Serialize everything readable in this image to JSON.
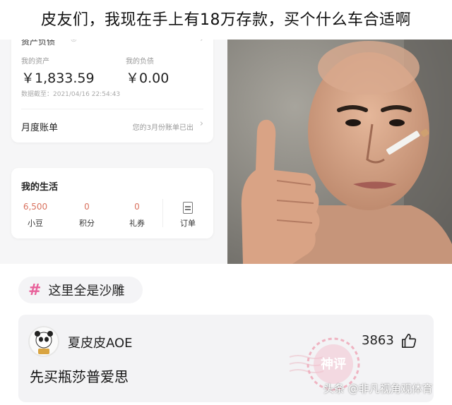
{
  "headline": "皮友们，我现在手上有18万存款，买个什么车合适啊",
  "screenshot": {
    "assets_title": "资产负债",
    "my_assets_label": "我的资产",
    "my_assets_value": "￥1,833.59",
    "my_debt_label": "我的负债",
    "my_debt_value": "￥0.00",
    "data_as_of": "数据截至：2021/04/16 22:54:43",
    "monthly_bill_title": "月度账单",
    "monthly_bill_note": "您的3月份账单已出",
    "life_title": "我的生活",
    "life_items": [
      {
        "num": "6,500",
        "label": "小豆"
      },
      {
        "num": "0",
        "label": "积分"
      },
      {
        "num": "0",
        "label": "礼券"
      }
    ],
    "order_label": "订单"
  },
  "tag": {
    "icon": "#",
    "text": "这里全是沙雕",
    "accent": "#e8619a"
  },
  "comment": {
    "user": "夏皮皮AOE",
    "likes": "3863",
    "text": "先买瓶莎普爱思",
    "stamp_text": "神评"
  },
  "watermark": "头条 @非凡视角观体育"
}
